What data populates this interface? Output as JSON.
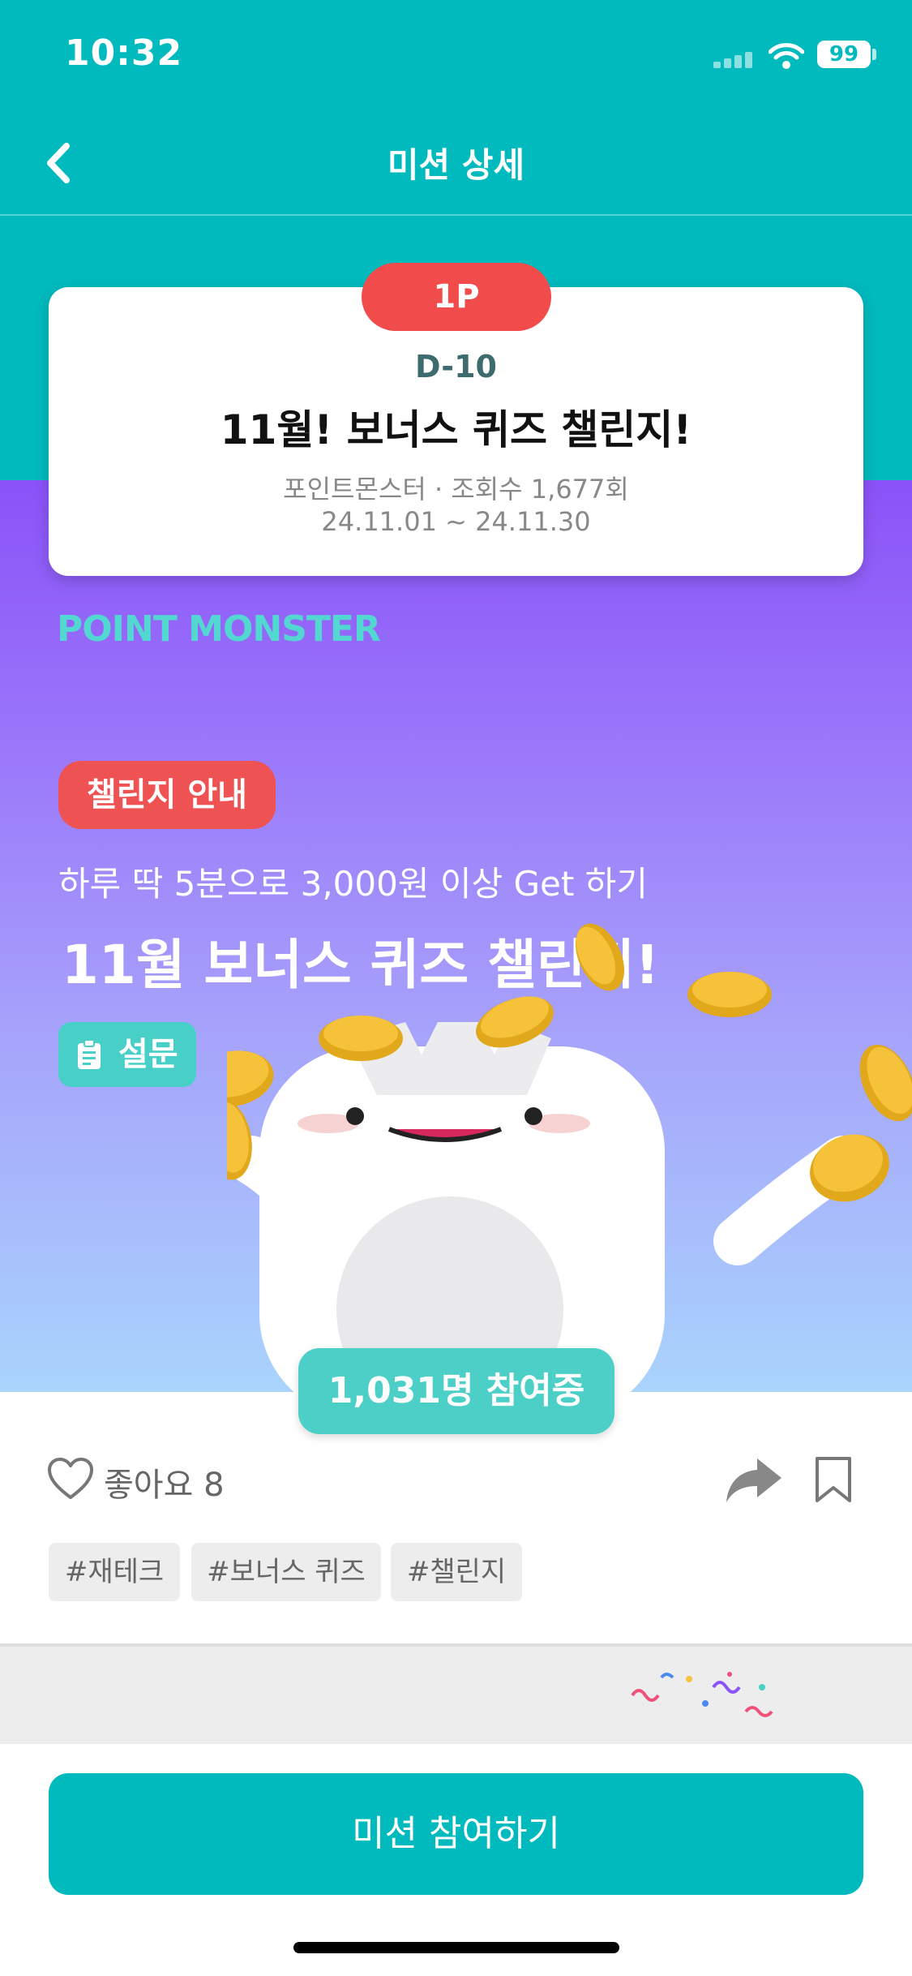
{
  "status": {
    "time": "10:32",
    "battery": "99"
  },
  "nav": {
    "title": "미션 상세"
  },
  "card": {
    "point_badge": "1P",
    "dday": "D-10",
    "title": "11월! 보너스 퀴즈 챌린지!",
    "meta": "포인트몬스터 · 조회수 1,677회",
    "date_range": "24.11.01 ~ 24.11.30"
  },
  "hero": {
    "brand": "POINT MONSTER",
    "guide_badge": "챌린지 안내",
    "subtitle": "하루 딱 5분으로 3,000원 이상 Get 하기",
    "title": "11월 보너스 퀴즈 챌린지!",
    "category": "설문",
    "participants": "1,031명 참여중"
  },
  "actions": {
    "likes": "좋아요 8"
  },
  "tags": [
    "#재테크",
    "#보너스 퀴즈",
    "#챌린지"
  ],
  "cta": {
    "label": "미션 참여하기"
  },
  "colors": {
    "teal": "#00BABE",
    "red": "#F24B4B",
    "purple": "#8A52F8",
    "mint": "#4BCFC6"
  }
}
